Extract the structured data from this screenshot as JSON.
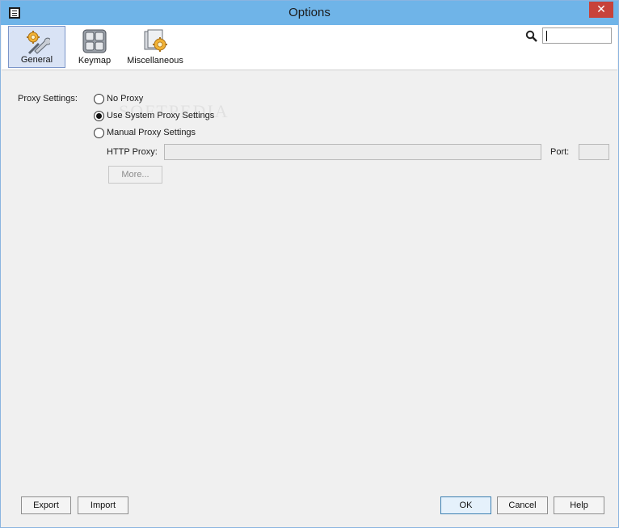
{
  "window": {
    "title": "Options"
  },
  "toolbar": {
    "items": [
      {
        "label": "General",
        "icon": "wrench-gear-icon",
        "selected": true
      },
      {
        "label": "Keymap",
        "icon": "keyboard-icon",
        "selected": false
      },
      {
        "label": "Miscellaneous",
        "icon": "misc-gear-icon",
        "selected": false
      }
    ],
    "search": {
      "icon": "search-icon",
      "value": ""
    }
  },
  "proxy": {
    "label": "Proxy Settings:",
    "options": [
      {
        "label": "No Proxy",
        "checked": false
      },
      {
        "label": "Use System Proxy Settings",
        "checked": true
      },
      {
        "label": "Manual Proxy Settings",
        "checked": false
      }
    ],
    "http_proxy_label": "HTTP Proxy:",
    "http_proxy_value": "",
    "port_label": "Port:",
    "port_value": "",
    "more_label": "More..."
  },
  "footer": {
    "export_label": "Export",
    "import_label": "Import",
    "ok_label": "OK",
    "cancel_label": "Cancel",
    "help_label": "Help"
  },
  "colors": {
    "titlebar": "#6fb4e8",
    "close": "#c7423a",
    "selected_tab": "#d9e3f5"
  }
}
